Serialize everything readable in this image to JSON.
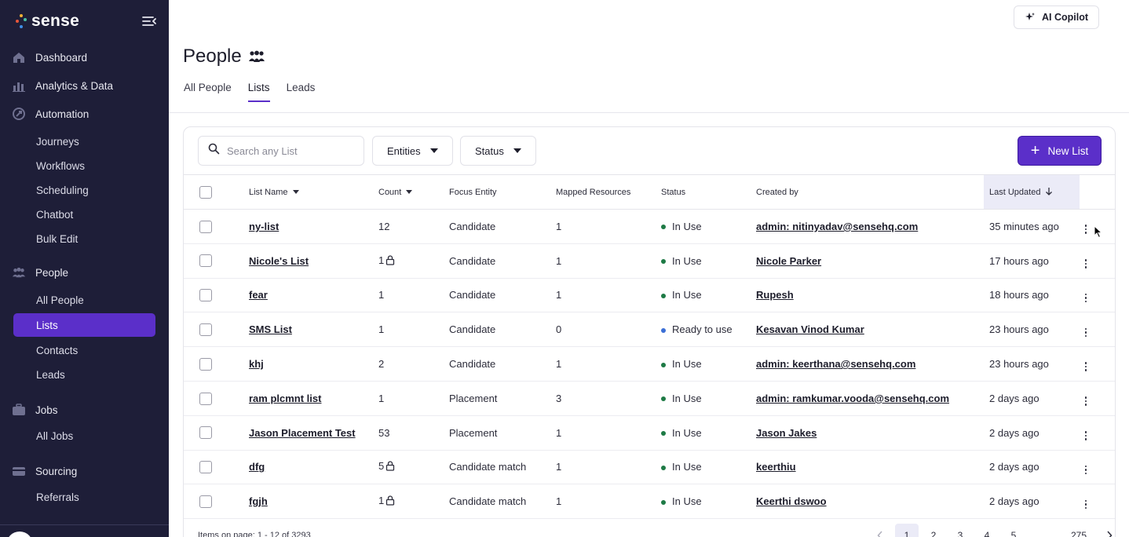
{
  "brand": {
    "name": "sense",
    "dot_colors": [
      "#f2b134",
      "#e8563a",
      "#5b2fc9",
      "#4ac2a5",
      "#3f8ee6"
    ]
  },
  "sidebar": {
    "sections": [
      {
        "label": "Dashboard",
        "icon": "home-icon",
        "items": []
      },
      {
        "label": "Analytics & Data",
        "icon": "chart-icon",
        "items": []
      },
      {
        "label": "Automation",
        "icon": "automation-icon",
        "items": [
          "Journeys",
          "Workflows",
          "Scheduling",
          "Chatbot",
          "Bulk Edit"
        ]
      },
      {
        "label": "People",
        "icon": "people-icon",
        "items": [
          "All People",
          "Lists",
          "Contacts",
          "Leads"
        ]
      },
      {
        "label": "Jobs",
        "icon": "briefcase-icon",
        "items": [
          "All Jobs"
        ]
      },
      {
        "label": "Sourcing",
        "icon": "sourcing-icon",
        "items": [
          "Referrals"
        ]
      }
    ],
    "active_item": "Lists"
  },
  "header": {
    "copilot_label": "AI Copilot",
    "title": "People",
    "tabs": [
      {
        "label": "All People",
        "active": false
      },
      {
        "label": "Lists",
        "active": true
      },
      {
        "label": "Leads",
        "active": false
      }
    ]
  },
  "toolbar": {
    "search_placeholder": "Search any List",
    "entities_label": "Entities",
    "status_label": "Status",
    "new_list_label": "New List"
  },
  "table": {
    "columns": {
      "list_name": "List Name",
      "count": "Count",
      "focus_entity": "Focus Entity",
      "mapped_resources": "Mapped Resources",
      "status": "Status",
      "created_by": "Created by",
      "last_updated": "Last Updated"
    },
    "rows": [
      {
        "name": "ny-list",
        "count": "12",
        "locked": false,
        "entity": "Candidate",
        "mapped": "1",
        "status": "In Use",
        "creator": "admin: nitinyadav@sensehq.com",
        "updated": "35 minutes ago"
      },
      {
        "name": "Nicole's List",
        "count": "1",
        "locked": true,
        "entity": "Candidate",
        "mapped": "1",
        "status": "In Use",
        "creator": "Nicole Parker",
        "updated": "17 hours ago"
      },
      {
        "name": "fear",
        "count": "1",
        "locked": false,
        "entity": "Candidate",
        "mapped": "1",
        "status": "In Use",
        "creator": "Rupesh",
        "updated": "18 hours ago"
      },
      {
        "name": "SMS List",
        "count": "1",
        "locked": false,
        "entity": "Candidate",
        "mapped": "0",
        "status": "Ready to use",
        "creator": "Kesavan Vinod Kumar",
        "updated": "23 hours ago"
      },
      {
        "name": "khj",
        "count": "2",
        "locked": false,
        "entity": "Candidate",
        "mapped": "1",
        "status": "In Use",
        "creator": "admin: keerthana@sensehq.com",
        "updated": "23 hours ago"
      },
      {
        "name": "ram plcmnt list",
        "count": "1",
        "locked": false,
        "entity": "Placement",
        "mapped": "3",
        "status": "In Use",
        "creator": "admin: ramkumar.vooda@sensehq.com",
        "updated": "2 days ago"
      },
      {
        "name": "Jason Placement Test",
        "count": "53",
        "locked": false,
        "entity": "Placement",
        "mapped": "1",
        "status": "In Use",
        "creator": "Jason Jakes",
        "updated": "2 days ago"
      },
      {
        "name": "dfg",
        "count": "5",
        "locked": true,
        "entity": "Candidate match",
        "mapped": "1",
        "status": "In Use",
        "creator": "keerthiu",
        "updated": "2 days ago"
      },
      {
        "name": "fgjh",
        "count": "1",
        "locked": true,
        "entity": "Candidate match",
        "mapped": "1",
        "status": "In Use",
        "creator": "Keerthi dswoo",
        "updated": "2 days ago"
      }
    ],
    "status_colors": {
      "In Use": "#1e7a45",
      "Ready to use": "#3b6fd6"
    }
  },
  "footer": {
    "items_info": "Items on page: 1 - 12 of 3293",
    "pages": [
      "1",
      "2",
      "3",
      "4",
      "5",
      "...",
      "275"
    ],
    "current_page": "1"
  },
  "colors": {
    "accent": "#5b2fc9",
    "sidebar_bg": "#1e1e38"
  }
}
